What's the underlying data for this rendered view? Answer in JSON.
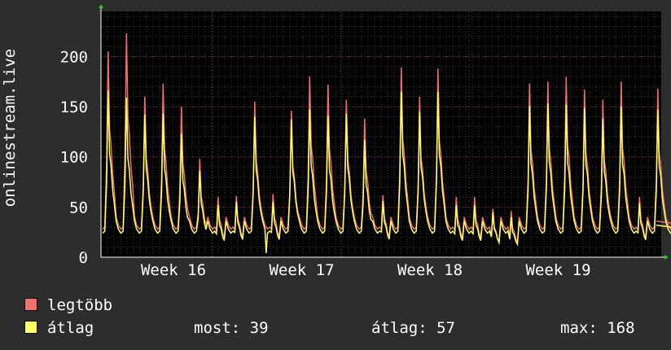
{
  "chart_data": {
    "type": "line",
    "ylabel": "onlinestream.live",
    "yticks": [
      0,
      50,
      100,
      150,
      200
    ],
    "ylim": [
      0,
      245
    ],
    "xticks": [
      "Week 16",
      "Week 17",
      "Week 18",
      "Week 19"
    ],
    "grid": true,
    "colors": {
      "background": "#2d2d2d",
      "plot": "#000000",
      "grid": "#5a2020",
      "axis": "#ffffff",
      "arrow": "#22cc22"
    },
    "series": [
      {
        "name": "legtöbb",
        "color": "#f07070",
        "daily_peaks": [
          205,
          223,
          160,
          173,
          150,
          98,
          60,
          61,
          155,
          63,
          146,
          180,
          172,
          157,
          138,
          62,
          189,
          160,
          188,
          60,
          60,
          48,
          46,
          173,
          175,
          180,
          167,
          157,
          175,
          60,
          168,
          100
        ]
      },
      {
        "name": "átlag",
        "color": "#ffff66",
        "daily_peaks": [
          166,
          159,
          142,
          143,
          123,
          86,
          52,
          55,
          140,
          55,
          137,
          147,
          141,
          143,
          117,
          56,
          165,
          145,
          165,
          52,
          52,
          45,
          40,
          151,
          153,
          152,
          149,
          138,
          150,
          54,
          147,
          90
        ]
      }
    ]
  },
  "legend": {
    "max_label": "legtöbb",
    "avg_label": "átlag",
    "now_stat": "most: 39",
    "avg_stat": "átlag: 57",
    "max_stat": "max: 168"
  }
}
